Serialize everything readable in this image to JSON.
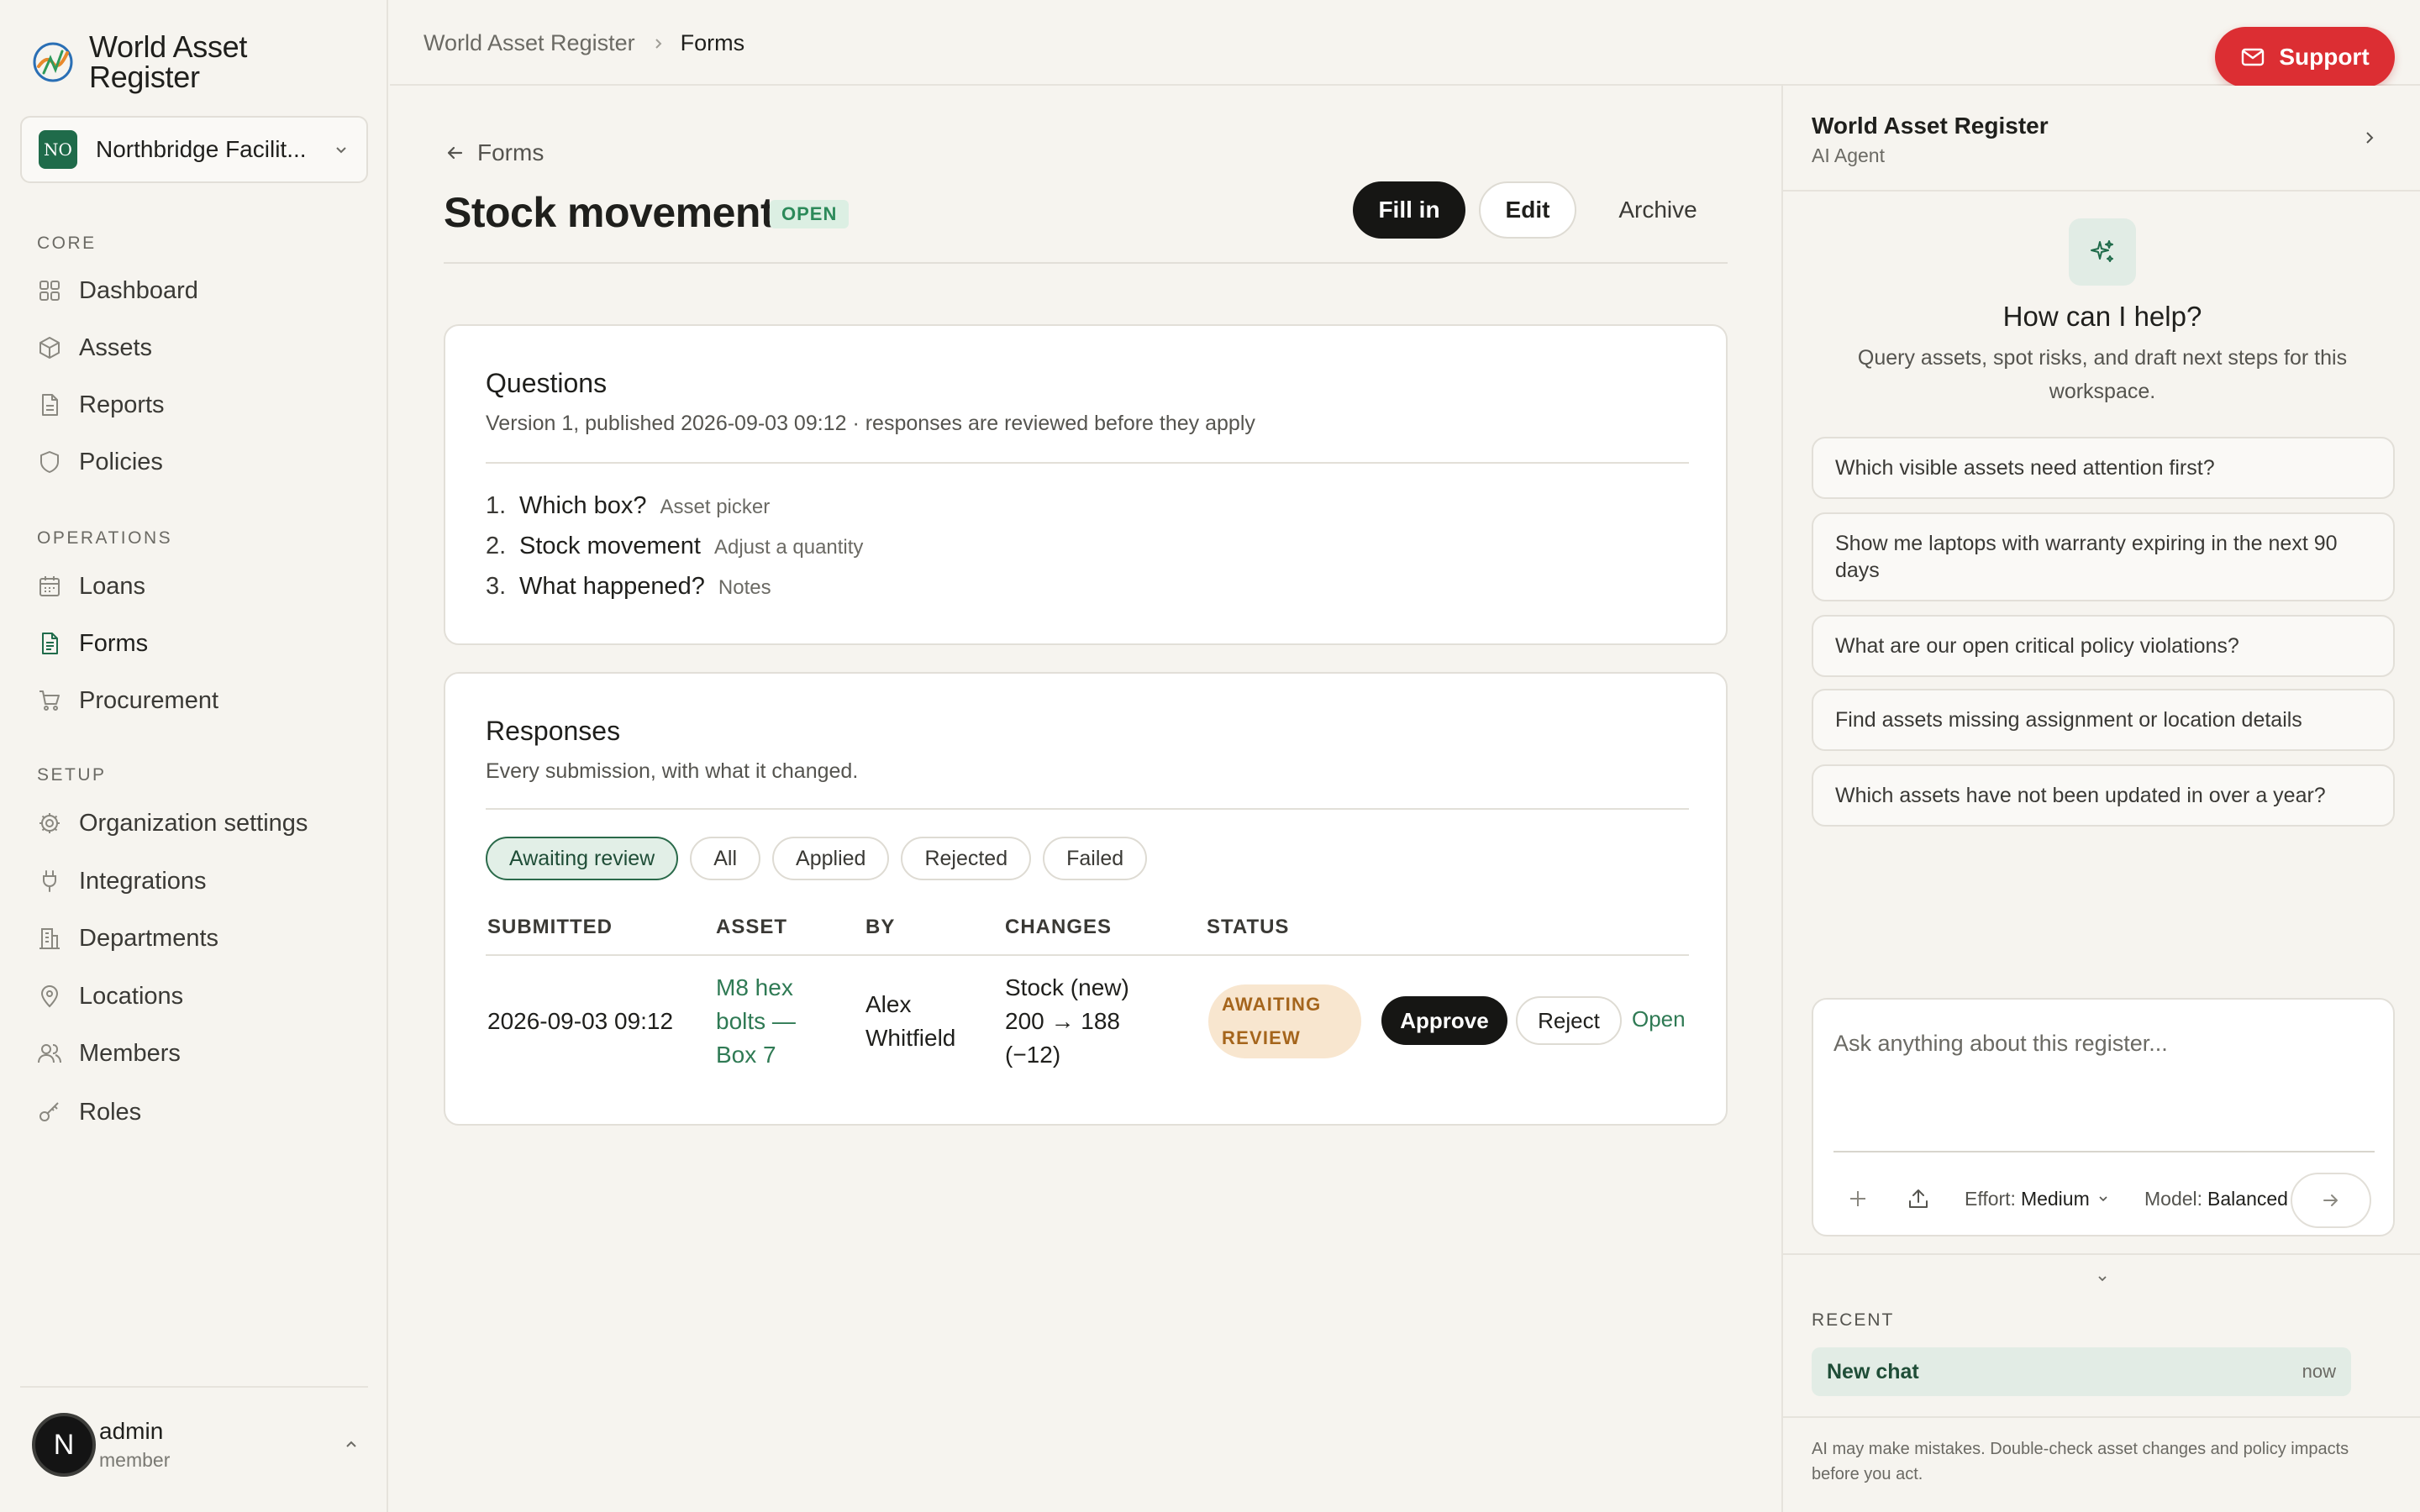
{
  "app": {
    "name": "World Asset Register"
  },
  "org": {
    "initials": "NO",
    "name": "Northbridge Facilit..."
  },
  "nav": {
    "core_label": "CORE",
    "operations_label": "OPERATIONS",
    "setup_label": "SETUP",
    "core": [
      {
        "label": "Dashboard",
        "icon": "dashboard-icon"
      },
      {
        "label": "Assets",
        "icon": "box-icon"
      },
      {
        "label": "Reports",
        "icon": "document-icon"
      },
      {
        "label": "Policies",
        "icon": "shield-icon"
      }
    ],
    "operations": [
      {
        "label": "Loans",
        "icon": "calendar-icon"
      },
      {
        "label": "Forms",
        "icon": "form-icon",
        "active": true
      },
      {
        "label": "Procurement",
        "icon": "cart-icon"
      }
    ],
    "setup": [
      {
        "label": "Organization settings",
        "icon": "gear-icon"
      },
      {
        "label": "Integrations",
        "icon": "plug-icon"
      },
      {
        "label": "Departments",
        "icon": "building-icon"
      },
      {
        "label": "Locations",
        "icon": "pin-icon"
      },
      {
        "label": "Members",
        "icon": "users-icon"
      },
      {
        "label": "Roles",
        "icon": "key-icon"
      }
    ]
  },
  "user": {
    "avatar_letter": "N",
    "name": "admin",
    "role": "member"
  },
  "breadcrumb": {
    "root": "World Asset Register",
    "current": "Forms"
  },
  "support": {
    "label": "Support"
  },
  "page": {
    "back_label": "Forms",
    "title": "Stock movement",
    "status_badge": "OPEN",
    "actions": {
      "fill_in": "Fill in",
      "edit": "Edit",
      "archive": "Archive"
    }
  },
  "questions": {
    "title": "Questions",
    "subtitle": "Version 1, published 2026-09-03 09:12 · responses are reviewed before they apply",
    "items": [
      {
        "num": "1.",
        "label": "Which box?",
        "type": "Asset picker"
      },
      {
        "num": "2.",
        "label": "Stock movement",
        "type": "Adjust a quantity"
      },
      {
        "num": "3.",
        "label": "What happened?",
        "type": "Notes"
      }
    ]
  },
  "responses": {
    "title": "Responses",
    "subtitle": "Every submission, with what it changed.",
    "filters": [
      "Awaiting review",
      "All",
      "Applied",
      "Rejected",
      "Failed"
    ],
    "active_filter": "Awaiting review",
    "columns": [
      "SUBMITTED",
      "ASSET",
      "BY",
      "CHANGES",
      "STATUS"
    ],
    "rows": [
      {
        "submitted": "2026-09-03 09:12",
        "asset_lines": [
          "M8 hex",
          "bolts —",
          "Box 7"
        ],
        "by_lines": [
          "Alex",
          "Whitfield"
        ],
        "changes_lines": [
          "Stock (new)",
          "200 → 188",
          "(−12)"
        ],
        "status_lines": [
          "AWAITING",
          "REVIEW"
        ],
        "approve": "Approve",
        "reject": "Reject",
        "open": "Open"
      }
    ]
  },
  "ai": {
    "title": "World Asset Register",
    "subtitle": "AI Agent",
    "help_title": "How can I help?",
    "help_sub": "Query assets, spot risks, and draft next steps for this workspace.",
    "suggestions": [
      "Which visible assets need attention first?",
      "Show me laptops with warranty expiring in the next 90 days",
      "What are our open critical policy violations?",
      "Find assets missing assignment or location details",
      "Which assets have not been updated in over a year?"
    ],
    "input_placeholder": "Ask anything about this register...",
    "effort_label": "Effort:",
    "effort_value": "Medium",
    "model_label": "Model:",
    "model_value": "Balanced",
    "recent_label": "RECENT",
    "recent": [
      {
        "title": "New chat",
        "time": "now"
      }
    ],
    "disclaimer": "AI may make mistakes. Double-check asset changes and policy impacts before you act."
  },
  "colors": {
    "brand_green": "#1f6b4a",
    "support_red": "#dc2e33",
    "link_green": "#2f7a54",
    "awaiting_bg": "#f8e6cf",
    "awaiting_text": "#a5651c",
    "open_badge_bg": "#dcefe3"
  }
}
